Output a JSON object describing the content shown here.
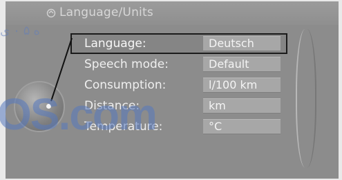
{
  "header": {
    "title": "Language/Units",
    "icon": "settings-icon"
  },
  "settings": {
    "rows": [
      {
        "label": "Language:",
        "value": "Deutsch"
      },
      {
        "label": "Speech mode:",
        "value": "Default"
      },
      {
        "label": "Consumption:",
        "value": "l/100 km"
      },
      {
        "label": "Distance:",
        "value": "km"
      },
      {
        "label": "Temperature:",
        "value": "°C"
      }
    ]
  },
  "overlay": {
    "watermark_big": "OS.com",
    "watermark_small": "ه ۵ ۰ ی"
  },
  "colors": {
    "background": "#8c8c8c",
    "value_box": "#a7a7a7",
    "selection_border": "#1b1b1b"
  }
}
